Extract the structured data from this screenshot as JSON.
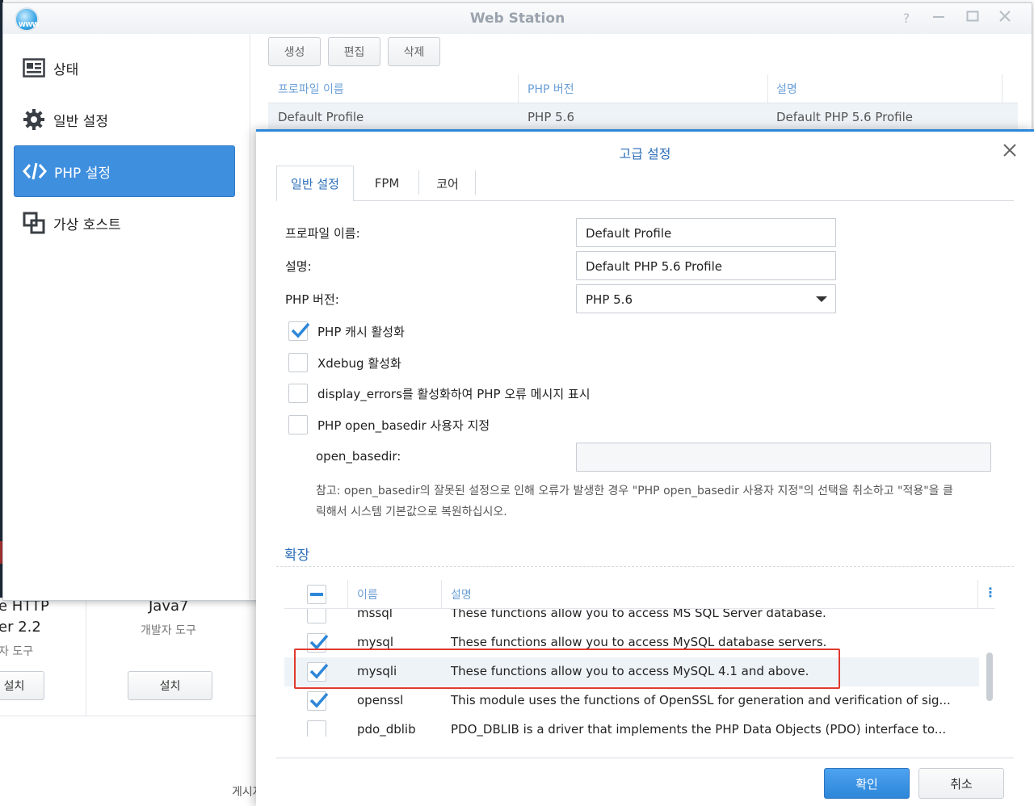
{
  "window": {
    "title": "Web Station"
  },
  "sidebar": {
    "items": [
      {
        "label": "상태",
        "icon": "status-icon"
      },
      {
        "label": "일반 설정",
        "icon": "gear-icon"
      },
      {
        "label": "PHP 설정",
        "icon": "code-icon",
        "active": true
      },
      {
        "label": "가상 호스트",
        "icon": "virtual-host-icon"
      }
    ]
  },
  "toolbar": {
    "create": "생성",
    "edit": "편집",
    "delete": "삭제"
  },
  "grid": {
    "columns": [
      "프로파일 이름",
      "PHP 버전",
      "설명"
    ],
    "rows": [
      [
        "Default Profile",
        "PHP 5.6",
        "Default PHP 5.6 Profile"
      ]
    ]
  },
  "background": {
    "pkg1_line1": "e HTTP",
    "pkg1_line2": "er 2.2",
    "pkg1_cat": "자 도구",
    "pkg1_btn": "설치",
    "pkg2_name": "Java7",
    "pkg2_cat": "개발자 도구",
    "pkg2_btn": "설치",
    "footer": "게시자"
  },
  "modal": {
    "title": "고급 설정",
    "tabs": [
      "일반 설정",
      "FPM",
      "코어"
    ],
    "profile_name_label": "프로파일 이름:",
    "profile_name_value": "Default Profile",
    "desc_label": "설명:",
    "desc_value": "Default PHP 5.6 Profile",
    "php_version_label": "PHP 버전:",
    "php_version_value": "PHP 5.6",
    "checks": [
      {
        "label": "PHP 캐시 활성화",
        "checked": true
      },
      {
        "label": "Xdebug 활성화",
        "checked": false
      },
      {
        "label": "display_errors를 활성화하여 PHP 오류 메시지 표시",
        "checked": false
      },
      {
        "label": "PHP open_basedir 사용자 지정",
        "checked": false
      }
    ],
    "open_basedir_label": "open_basedir:",
    "open_basedir_value": "",
    "note_line1": "참고: open_basedir의 잘못된 설정으로 인해 오류가 발생한 경우 \"PHP open_basedir 사용자 지정\"의 선택을 취소하고 \"적용\"을 클",
    "note_line2": "릭해서 시스템 기본값으로 복원하십시오.",
    "extension_section": "확장",
    "ext_columns": {
      "name": "이름",
      "desc": "설명"
    },
    "extensions": [
      {
        "name": "mssql",
        "desc": "These functions allow you to access MS SQL Server database.",
        "checked": false
      },
      {
        "name": "mysql",
        "desc": "These functions allow you to access MySQL database servers.",
        "checked": true
      },
      {
        "name": "mysqli",
        "desc": "These functions allow you to access MySQL 4.1 and above.",
        "checked": true,
        "selected": true
      },
      {
        "name": "openssl",
        "desc": "This module uses the functions of OpenSSL for generation and verification of sig...",
        "checked": true
      },
      {
        "name": "pdo_dblib",
        "desc": "PDO_DBLIB is a driver that implements the PHP Data Objects (PDO) interface to...",
        "checked": false
      }
    ],
    "ok": "확인",
    "cancel": "취소"
  },
  "colors": {
    "accent": "#3f8fdf",
    "highlight": "#e03a2f"
  }
}
